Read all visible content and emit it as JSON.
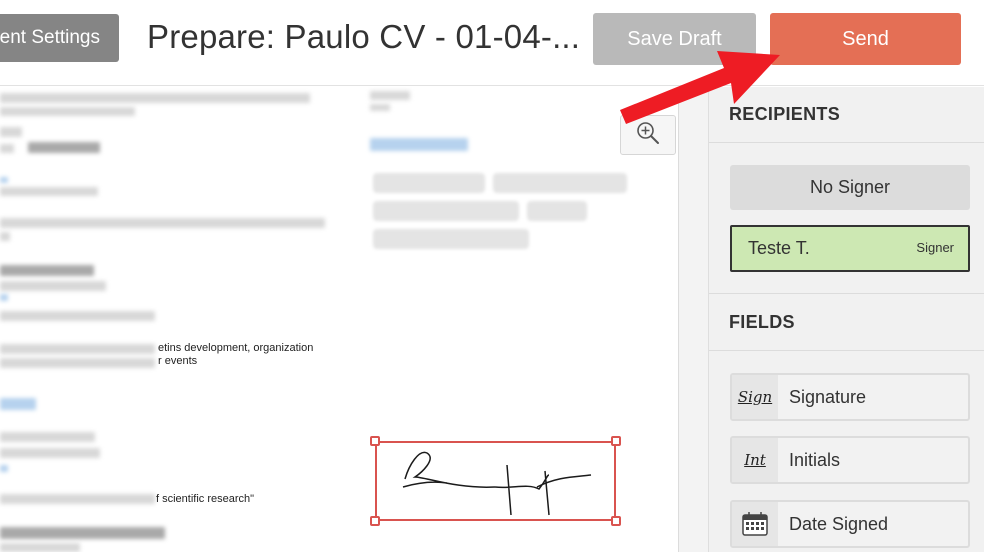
{
  "header": {
    "settings_label": "ent Settings",
    "title": "Prepare: Paulo CV - 01-04-...",
    "save_draft_label": "Save Draft",
    "send_label": "Send"
  },
  "document": {
    "text_line_1": "etins development, organization",
    "text_line_2": "r events",
    "text_line_3": "f scientific research\""
  },
  "sidebar": {
    "recipients_heading": "RECIPIENTS",
    "no_signer_label": "No Signer",
    "signer": {
      "name": "Teste T.",
      "role": "Signer"
    },
    "fields_heading": "FIELDS",
    "fields": [
      {
        "label": "Signature",
        "icon": "signature-icon",
        "glyph": "Sign"
      },
      {
        "label": "Initials",
        "icon": "initials-icon",
        "glyph": "Int"
      },
      {
        "label": "Date Signed",
        "icon": "calendar-icon"
      }
    ]
  },
  "colors": {
    "send": "#e46f55",
    "save_draft": "#b9b9b9",
    "settings": "#858585",
    "signer_bg": "#cde8b3",
    "selection": "#d9534f",
    "annotation_arrow": "#ee1c24"
  }
}
